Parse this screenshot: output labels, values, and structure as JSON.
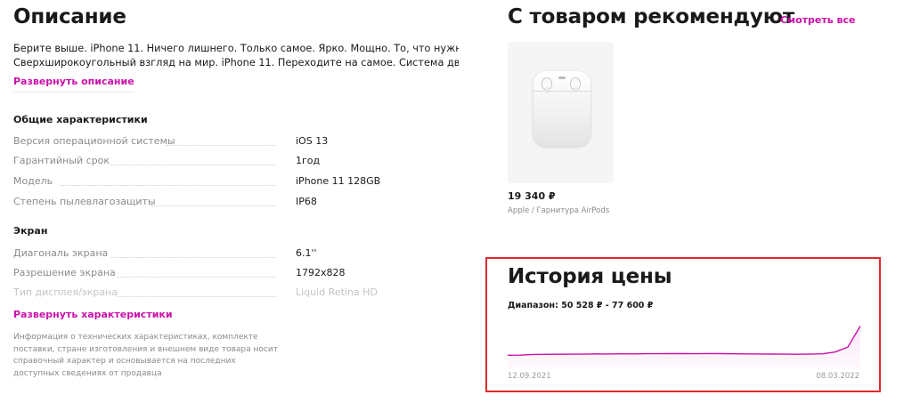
{
  "description": {
    "title": "Описание",
    "lines": [
      "Берите выше. iPhone 11. Ничего лишнего. Только самое. Ярко. Мощно. То, что нужно.",
      "Сверхширокоугольный взгляд на мир. iPhone 11. Переходите на самое. Система двух камер со"
    ],
    "expand_label": "Развернуть описание"
  },
  "specs": {
    "general_title": "Общие характеристики",
    "general": [
      {
        "name": "Версия операционной системы",
        "value": "iOS 13"
      },
      {
        "name": "Гарантийный срок",
        "value": "1год"
      },
      {
        "name": "Модель",
        "value": "iPhone 11 128GB"
      },
      {
        "name": "Степень пылевлагозащиты",
        "value": "IP68"
      }
    ],
    "screen_title": "Экран",
    "screen": [
      {
        "name": "Диагональ экрана",
        "value": "6.1''"
      },
      {
        "name": "Разрешение экрана",
        "value": "1792x828"
      },
      {
        "name": "Тип дисплея/экрана",
        "value": "Liquid Retina HD"
      }
    ],
    "expand_label": "Развернуть характеристики",
    "disclaimer": "Информация о технических характеристиках, комплекте поставки, стране изготовления и внешнем виде товара носит справочный характер и основывается на последних доступных сведениях от продавца"
  },
  "recommend": {
    "title": "С товаром рекомендуют",
    "see_all": "Смотреть все",
    "product": {
      "price": "19 340 ₽",
      "subtitle": "Apple / Гарнитура AirPods",
      "image_icon": "airpods-case-icon"
    }
  },
  "price_history": {
    "title": "История цены",
    "range": "Диапазон: 50 528 ₽ - 77 600 ₽",
    "start_date": "12.09.2021",
    "end_date": "08.03.2022",
    "line_color": "#cb11ab",
    "values": [
      50528,
      50560,
      51200,
      51350,
      51400,
      51500,
      51450,
      51700,
      51680,
      51800,
      51760,
      51900,
      51880,
      52000,
      51950,
      51900,
      52100,
      51980,
      51850,
      51700,
      51620,
      51600,
      51500,
      51400,
      51450,
      51800,
      53500,
      58000,
      77600
    ]
  },
  "colors": {
    "accent": "#cb11ab",
    "highlight_border": "#e0292e"
  }
}
